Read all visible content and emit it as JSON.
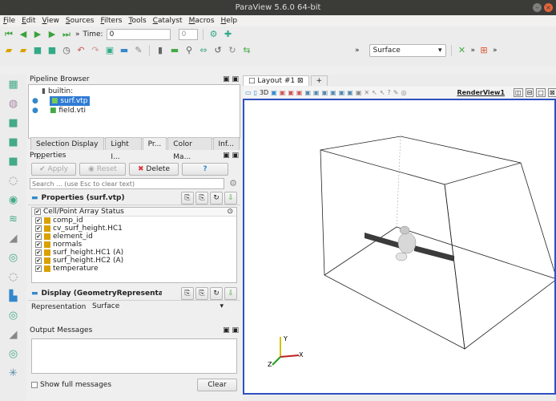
{
  "window": {
    "title": "ParaView 5.6.0 64-bit"
  },
  "menu": [
    "File",
    "Edit",
    "View",
    "Sources",
    "Filters",
    "Tools",
    "Catalyst",
    "Macros",
    "Help"
  ],
  "time": {
    "label": "Time:",
    "value": "0",
    "index": "0"
  },
  "representation_toolbar": {
    "value": "Surface"
  },
  "pipeline": {
    "title": "Pipeline Browser",
    "items": [
      {
        "label": "builtin:"
      },
      {
        "label": "surf.vtp"
      },
      {
        "label": "field.vti"
      }
    ]
  },
  "tabs": [
    "Selection Display I...",
    "Light I...",
    "Pr...",
    "Color Ma...",
    "Inf..."
  ],
  "properties": {
    "title": "Properties",
    "apply": "Apply",
    "reset": "Reset",
    "delete": "Delete",
    "help": "?",
    "search_placeholder": "Search ... (use Esc to clear text)",
    "section_title": "Properties (surf.vtp)",
    "array_header": "Cell/Point Array Status",
    "arrays": [
      "comp_id",
      "cv_surf_height.HC1",
      "element_id",
      "normals",
      "surf_height.HC1 (A)",
      "surf_height.HC2 (A)",
      "temperature"
    ],
    "display_title": "Display (GeometryRepresentation",
    "repr_label": "Representation",
    "repr_value": "Surface"
  },
  "output": {
    "title": "Output Messages",
    "show_full": "Show full messages",
    "clear": "Clear"
  },
  "layout": {
    "tab": "Layout #1",
    "add": "+",
    "view_name": "RenderView1",
    "toolbar_glyphs": "3D"
  },
  "axes": {
    "x": "X",
    "y": "Y",
    "z": "Z"
  },
  "colors": {
    "accent": "#2f7bd5",
    "view_border": "#3050c0"
  }
}
